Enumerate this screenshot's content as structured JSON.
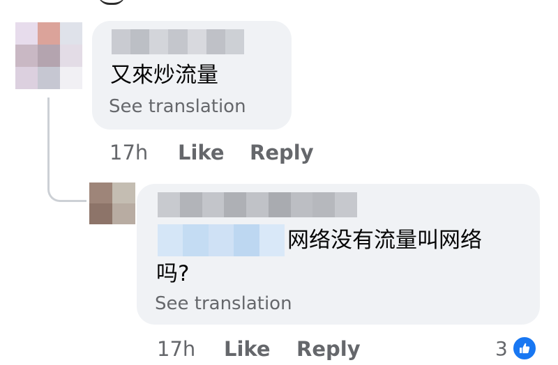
{
  "comments": [
    {
      "text": "又來炒流量",
      "translate_label": "See translation",
      "time": "17h",
      "like_label": "Like",
      "reply_label": "Reply"
    },
    {
      "text_line1": "网络没有流量叫网络",
      "text_line2": "吗?",
      "translate_label": "See translation",
      "time": "17h",
      "like_label": "Like",
      "reply_label": "Reply",
      "reaction_count": "3",
      "reaction_icon": "like-thumbs-up-icon"
    }
  ],
  "colors": {
    "bubble_bg": "#f0f2f5",
    "secondary_text": "#65676b",
    "primary_text": "#050505",
    "like_blue": "#1877f2",
    "thread_line": "#ccd0d5"
  },
  "avatar_1_pixels": [
    "#e7dcec",
    "#dba39a",
    "#dfe2ea",
    "#c9b8c4",
    "#b4a4af",
    "#e3dce6",
    "#dcd0df",
    "#c6c7d2",
    "#f1f0f4"
  ],
  "avatar_2_pixels": [
    "#9e8579",
    "#c4bdb2",
    "#8d7469",
    "#b8aca2"
  ],
  "name_1_pixels": [
    "#c9cbd1",
    "#bcbfc5",
    "#d3d5da",
    "#c4c6cc",
    "#d8d9de",
    "#bfc1c7",
    "#cdd0d5"
  ],
  "name_2_pixels": [
    "#c8cacf",
    "#b2b4b9",
    "#c3c5ca",
    "#aeb0b5",
    "#c0c2c7",
    "#a9abb0",
    "#bcbec3",
    "#b6b8bd",
    "#c6c8cd"
  ],
  "mention_pixels": [
    "#d5e6f7",
    "#c4dcf3",
    "#cfe1f5",
    "#bdd7f1",
    "#d9e8f8"
  ]
}
